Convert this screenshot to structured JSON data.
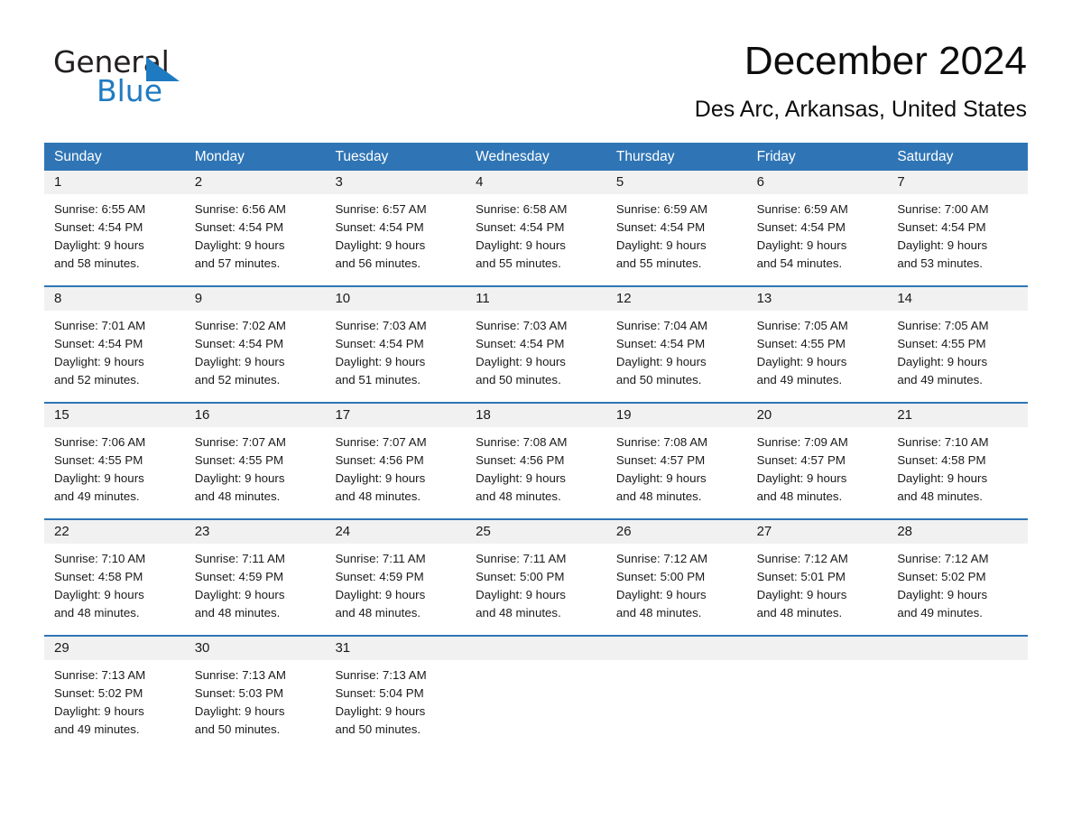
{
  "logo": {
    "word1": "General",
    "word2": "Blue",
    "triangle_color": "#1f7bc1"
  },
  "header": {
    "month_title": "December 2024",
    "location": "Des Arc, Arkansas, United States"
  },
  "theme": {
    "header_blue": "#2f75b5",
    "date_row_gray": "#f1f1f1",
    "text_color": "#1a1a1a"
  },
  "calendar": {
    "weekday_headers": [
      "Sunday",
      "Monday",
      "Tuesday",
      "Wednesday",
      "Thursday",
      "Friday",
      "Saturday"
    ],
    "weeks": [
      [
        {
          "day": "1",
          "sunrise": "Sunrise: 6:55 AM",
          "sunset": "Sunset: 4:54 PM",
          "daylight1": "Daylight: 9 hours",
          "daylight2": "and 58 minutes."
        },
        {
          "day": "2",
          "sunrise": "Sunrise: 6:56 AM",
          "sunset": "Sunset: 4:54 PM",
          "daylight1": "Daylight: 9 hours",
          "daylight2": "and 57 minutes."
        },
        {
          "day": "3",
          "sunrise": "Sunrise: 6:57 AM",
          "sunset": "Sunset: 4:54 PM",
          "daylight1": "Daylight: 9 hours",
          "daylight2": "and 56 minutes."
        },
        {
          "day": "4",
          "sunrise": "Sunrise: 6:58 AM",
          "sunset": "Sunset: 4:54 PM",
          "daylight1": "Daylight: 9 hours",
          "daylight2": "and 55 minutes."
        },
        {
          "day": "5",
          "sunrise": "Sunrise: 6:59 AM",
          "sunset": "Sunset: 4:54 PM",
          "daylight1": "Daylight: 9 hours",
          "daylight2": "and 55 minutes."
        },
        {
          "day": "6",
          "sunrise": "Sunrise: 6:59 AM",
          "sunset": "Sunset: 4:54 PM",
          "daylight1": "Daylight: 9 hours",
          "daylight2": "and 54 minutes."
        },
        {
          "day": "7",
          "sunrise": "Sunrise: 7:00 AM",
          "sunset": "Sunset: 4:54 PM",
          "daylight1": "Daylight: 9 hours",
          "daylight2": "and 53 minutes."
        }
      ],
      [
        {
          "day": "8",
          "sunrise": "Sunrise: 7:01 AM",
          "sunset": "Sunset: 4:54 PM",
          "daylight1": "Daylight: 9 hours",
          "daylight2": "and 52 minutes."
        },
        {
          "day": "9",
          "sunrise": "Sunrise: 7:02 AM",
          "sunset": "Sunset: 4:54 PM",
          "daylight1": "Daylight: 9 hours",
          "daylight2": "and 52 minutes."
        },
        {
          "day": "10",
          "sunrise": "Sunrise: 7:03 AM",
          "sunset": "Sunset: 4:54 PM",
          "daylight1": "Daylight: 9 hours",
          "daylight2": "and 51 minutes."
        },
        {
          "day": "11",
          "sunrise": "Sunrise: 7:03 AM",
          "sunset": "Sunset: 4:54 PM",
          "daylight1": "Daylight: 9 hours",
          "daylight2": "and 50 minutes."
        },
        {
          "day": "12",
          "sunrise": "Sunrise: 7:04 AM",
          "sunset": "Sunset: 4:54 PM",
          "daylight1": "Daylight: 9 hours",
          "daylight2": "and 50 minutes."
        },
        {
          "day": "13",
          "sunrise": "Sunrise: 7:05 AM",
          "sunset": "Sunset: 4:55 PM",
          "daylight1": "Daylight: 9 hours",
          "daylight2": "and 49 minutes."
        },
        {
          "day": "14",
          "sunrise": "Sunrise: 7:05 AM",
          "sunset": "Sunset: 4:55 PM",
          "daylight1": "Daylight: 9 hours",
          "daylight2": "and 49 minutes."
        }
      ],
      [
        {
          "day": "15",
          "sunrise": "Sunrise: 7:06 AM",
          "sunset": "Sunset: 4:55 PM",
          "daylight1": "Daylight: 9 hours",
          "daylight2": "and 49 minutes."
        },
        {
          "day": "16",
          "sunrise": "Sunrise: 7:07 AM",
          "sunset": "Sunset: 4:55 PM",
          "daylight1": "Daylight: 9 hours",
          "daylight2": "and 48 minutes."
        },
        {
          "day": "17",
          "sunrise": "Sunrise: 7:07 AM",
          "sunset": "Sunset: 4:56 PM",
          "daylight1": "Daylight: 9 hours",
          "daylight2": "and 48 minutes."
        },
        {
          "day": "18",
          "sunrise": "Sunrise: 7:08 AM",
          "sunset": "Sunset: 4:56 PM",
          "daylight1": "Daylight: 9 hours",
          "daylight2": "and 48 minutes."
        },
        {
          "day": "19",
          "sunrise": "Sunrise: 7:08 AM",
          "sunset": "Sunset: 4:57 PM",
          "daylight1": "Daylight: 9 hours",
          "daylight2": "and 48 minutes."
        },
        {
          "day": "20",
          "sunrise": "Sunrise: 7:09 AM",
          "sunset": "Sunset: 4:57 PM",
          "daylight1": "Daylight: 9 hours",
          "daylight2": "and 48 minutes."
        },
        {
          "day": "21",
          "sunrise": "Sunrise: 7:10 AM",
          "sunset": "Sunset: 4:58 PM",
          "daylight1": "Daylight: 9 hours",
          "daylight2": "and 48 minutes."
        }
      ],
      [
        {
          "day": "22",
          "sunrise": "Sunrise: 7:10 AM",
          "sunset": "Sunset: 4:58 PM",
          "daylight1": "Daylight: 9 hours",
          "daylight2": "and 48 minutes."
        },
        {
          "day": "23",
          "sunrise": "Sunrise: 7:11 AM",
          "sunset": "Sunset: 4:59 PM",
          "daylight1": "Daylight: 9 hours",
          "daylight2": "and 48 minutes."
        },
        {
          "day": "24",
          "sunrise": "Sunrise: 7:11 AM",
          "sunset": "Sunset: 4:59 PM",
          "daylight1": "Daylight: 9 hours",
          "daylight2": "and 48 minutes."
        },
        {
          "day": "25",
          "sunrise": "Sunrise: 7:11 AM",
          "sunset": "Sunset: 5:00 PM",
          "daylight1": "Daylight: 9 hours",
          "daylight2": "and 48 minutes."
        },
        {
          "day": "26",
          "sunrise": "Sunrise: 7:12 AM",
          "sunset": "Sunset: 5:00 PM",
          "daylight1": "Daylight: 9 hours",
          "daylight2": "and 48 minutes."
        },
        {
          "day": "27",
          "sunrise": "Sunrise: 7:12 AM",
          "sunset": "Sunset: 5:01 PM",
          "daylight1": "Daylight: 9 hours",
          "daylight2": "and 48 minutes."
        },
        {
          "day": "28",
          "sunrise": "Sunrise: 7:12 AM",
          "sunset": "Sunset: 5:02 PM",
          "daylight1": "Daylight: 9 hours",
          "daylight2": "and 49 minutes."
        }
      ],
      [
        {
          "day": "29",
          "sunrise": "Sunrise: 7:13 AM",
          "sunset": "Sunset: 5:02 PM",
          "daylight1": "Daylight: 9 hours",
          "daylight2": "and 49 minutes."
        },
        {
          "day": "30",
          "sunrise": "Sunrise: 7:13 AM",
          "sunset": "Sunset: 5:03 PM",
          "daylight1": "Daylight: 9 hours",
          "daylight2": "and 50 minutes."
        },
        {
          "day": "31",
          "sunrise": "Sunrise: 7:13 AM",
          "sunset": "Sunset: 5:04 PM",
          "daylight1": "Daylight: 9 hours",
          "daylight2": "and 50 minutes."
        },
        {
          "day": "",
          "sunrise": "",
          "sunset": "",
          "daylight1": "",
          "daylight2": ""
        },
        {
          "day": "",
          "sunrise": "",
          "sunset": "",
          "daylight1": "",
          "daylight2": ""
        },
        {
          "day": "",
          "sunrise": "",
          "sunset": "",
          "daylight1": "",
          "daylight2": ""
        },
        {
          "day": "",
          "sunrise": "",
          "sunset": "",
          "daylight1": "",
          "daylight2": ""
        }
      ]
    ]
  }
}
